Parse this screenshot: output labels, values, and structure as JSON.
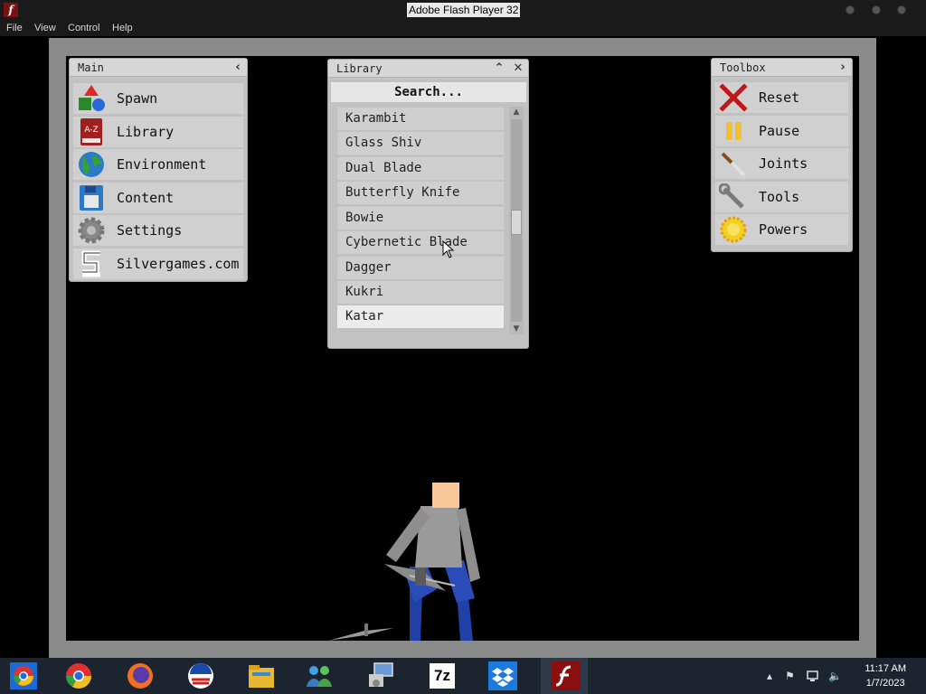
{
  "window": {
    "title": "Adobe Flash Player 32"
  },
  "menubar": {
    "items": [
      {
        "label": "File"
      },
      {
        "label": "View"
      },
      {
        "label": "Control"
      },
      {
        "label": "Help"
      }
    ]
  },
  "main_panel": {
    "title": "Main",
    "items": [
      {
        "label": "Spawn",
        "icon": "shapes-icon"
      },
      {
        "label": "Library",
        "icon": "a-z-book-icon"
      },
      {
        "label": "Environment",
        "icon": "globe-icon"
      },
      {
        "label": "Content",
        "icon": "floppy-disk-icon"
      },
      {
        "label": "Settings",
        "icon": "gear-icon"
      },
      {
        "label": "Silvergames.com",
        "icon": "silvergames-logo-icon"
      }
    ]
  },
  "library_panel": {
    "title": "Library",
    "search_label": "Search...",
    "items": [
      {
        "label": "Karambit"
      },
      {
        "label": "Glass Shiv"
      },
      {
        "label": "Dual Blade"
      },
      {
        "label": "Butterfly Knife"
      },
      {
        "label": "Bowie"
      },
      {
        "label": "Cybernetic Blade"
      },
      {
        "label": "Dagger"
      },
      {
        "label": "Kukri"
      },
      {
        "label": "Katar"
      }
    ],
    "selected": "Katar",
    "hovered": "Cybernetic Blade"
  },
  "toolbox_panel": {
    "title": "Toolbox",
    "items": [
      {
        "label": "Reset",
        "icon": "red-x-icon"
      },
      {
        "label": "Pause",
        "icon": "pause-icon"
      },
      {
        "label": "Joints",
        "icon": "knife-joint-icon"
      },
      {
        "label": "Tools",
        "icon": "wrench-icon"
      },
      {
        "label": "Powers",
        "icon": "sun-power-icon"
      }
    ]
  },
  "taskbar": {
    "time": "11:17 AM",
    "date": "1/7/2023",
    "icons": [
      "chrome-beta-icon",
      "chrome-icon",
      "firefox-icon",
      "obama-logo-icon",
      "file-explorer-icon",
      "network-people-icon",
      "remote-desktop-icon",
      "7zip-icon",
      "dropbox-icon",
      "flash-player-icon"
    ],
    "seven_zip_label": "7z"
  },
  "colors": {
    "panel_bg": "#c2c2c2",
    "stage_bg": "#000000",
    "frame": "#8a8a8a",
    "ragdoll_head": "#f8c79a",
    "ragdoll_body": "#9a9a9a",
    "ragdoll_legs": "#2040a8"
  }
}
